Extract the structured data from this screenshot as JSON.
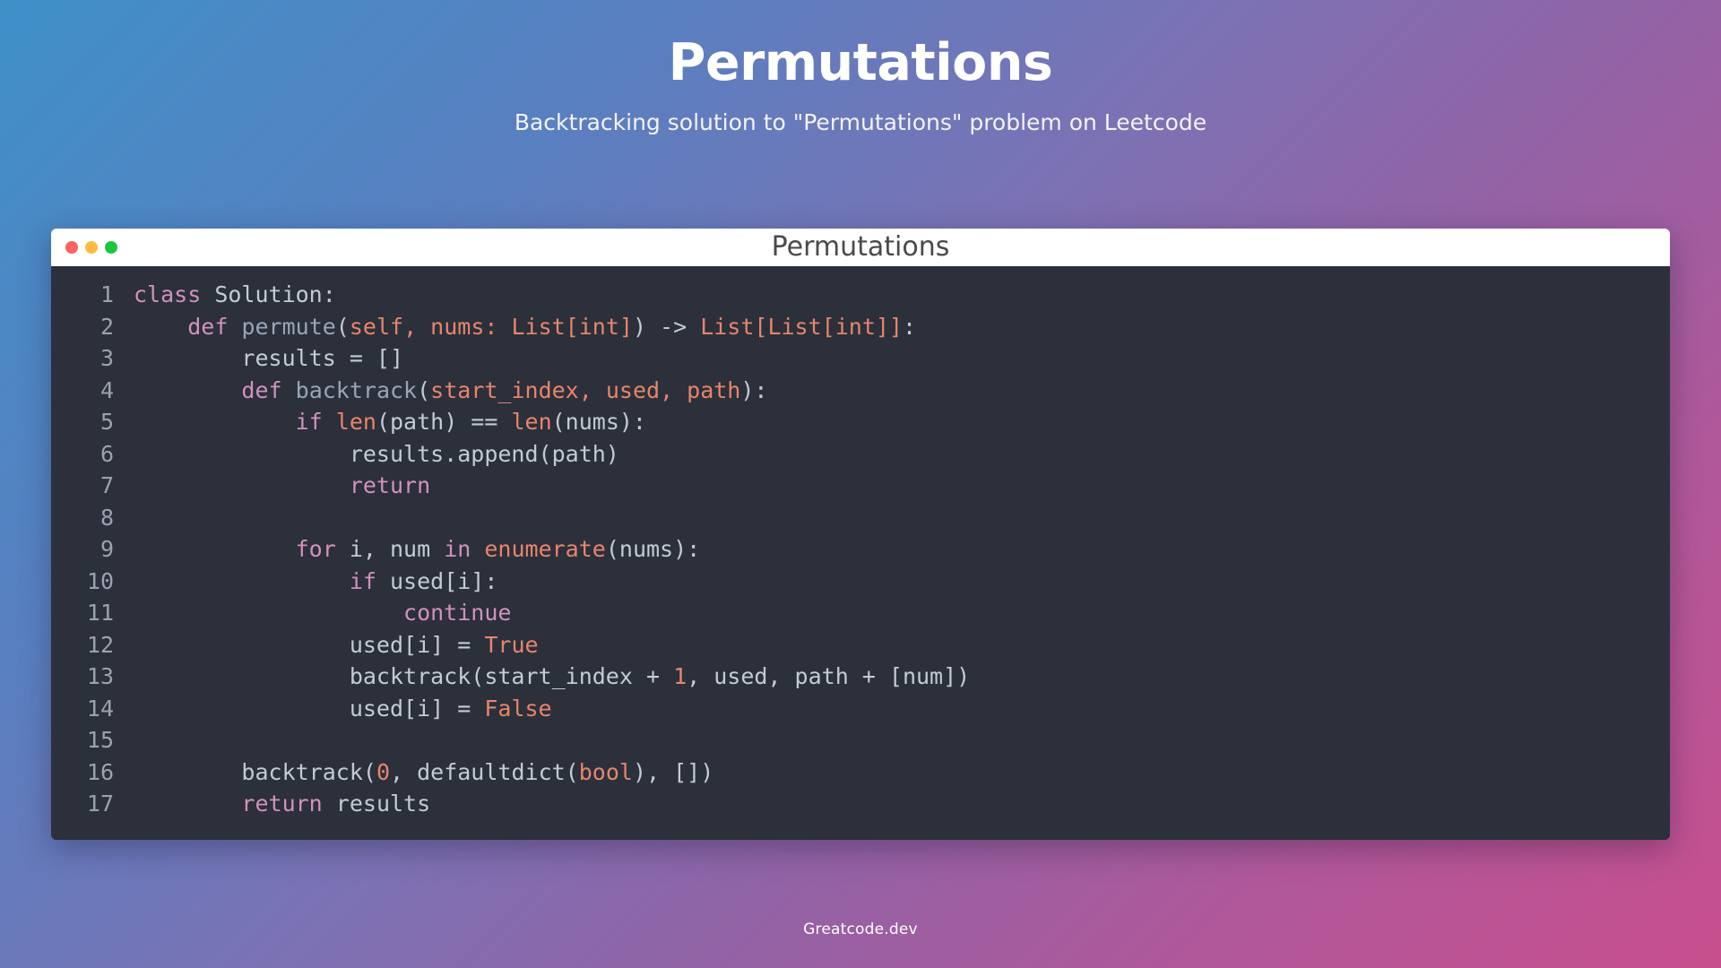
{
  "header": {
    "title": "Permutations",
    "subtitle": "Backtracking solution to \"Permutations\" problem on Leetcode"
  },
  "window": {
    "title": "Permutations",
    "traffic_lights": [
      {
        "name": "close",
        "color": "#fc625d"
      },
      {
        "name": "minimize",
        "color": "#fdbc40"
      },
      {
        "name": "maximize",
        "color": "#1cc73f"
      }
    ]
  },
  "footer": {
    "text": "Greatcode.dev"
  },
  "theme": {
    "background_start": "#3f90c8",
    "background_mid": "#9263a6",
    "background_end": "#c84f8e",
    "editor_background": "#2b303b",
    "titlebar_background": "#ffffff",
    "line_number_color": "#9aa2b1",
    "text_color": "#c5cbd6",
    "keyword_color": "#d291bc",
    "function_color": "#9aa5b8",
    "literal_color": "#e8856b"
  },
  "editor": {
    "language": "python",
    "line_numbers": [
      "1",
      "2",
      "3",
      "4",
      "5",
      "6",
      "7",
      "8",
      "9",
      "10",
      "11",
      "12",
      "13",
      "14",
      "15",
      "16",
      "17"
    ],
    "lines": [
      {
        "n": "1",
        "plain": "class Solution:"
      },
      {
        "n": "2",
        "plain": "    def permute(self, nums: List[int]) -> List[List[int]]:"
      },
      {
        "n": "3",
        "plain": "        results = []"
      },
      {
        "n": "4",
        "plain": "        def backtrack(start_index, used, path):"
      },
      {
        "n": "5",
        "plain": "            if len(path) == len(nums):"
      },
      {
        "n": "6",
        "plain": "                results.append(path)"
      },
      {
        "n": "7",
        "plain": "                return"
      },
      {
        "n": "8",
        "plain": ""
      },
      {
        "n": "9",
        "plain": "            for i, num in enumerate(nums):"
      },
      {
        "n": "10",
        "plain": "                if used[i]:"
      },
      {
        "n": "11",
        "plain": "                    continue"
      },
      {
        "n": "12",
        "plain": "                used[i] = True"
      },
      {
        "n": "13",
        "plain": "                backtrack(start_index + 1, used, path + [num])"
      },
      {
        "n": "14",
        "plain": "                used[i] = False"
      },
      {
        "n": "15",
        "plain": ""
      },
      {
        "n": "16",
        "plain": "        backtrack(0, defaultdict(bool), [])"
      },
      {
        "n": "17",
        "plain": "        return results"
      }
    ],
    "tokens": [
      [
        {
          "t": "class",
          "c": "kw"
        },
        {
          "t": " Solution:",
          "c": "pl"
        }
      ],
      [
        {
          "t": "    ",
          "c": "pl"
        },
        {
          "t": "def",
          "c": "kw"
        },
        {
          "t": " ",
          "c": "pl"
        },
        {
          "t": "permute",
          "c": "fn"
        },
        {
          "t": "(",
          "c": "pl"
        },
        {
          "t": "self, nums: List[int]",
          "c": "par"
        },
        {
          "t": ") -> ",
          "c": "pl"
        },
        {
          "t": "List[List[int]]",
          "c": "par"
        },
        {
          "t": ":",
          "c": "pl"
        }
      ],
      [
        {
          "t": "        results = []",
          "c": "pl"
        }
      ],
      [
        {
          "t": "        ",
          "c": "pl"
        },
        {
          "t": "def",
          "c": "kw"
        },
        {
          "t": " ",
          "c": "pl"
        },
        {
          "t": "backtrack",
          "c": "fn"
        },
        {
          "t": "(",
          "c": "pl"
        },
        {
          "t": "start_index, used, path",
          "c": "par"
        },
        {
          "t": "):",
          "c": "pl"
        }
      ],
      [
        {
          "t": "            ",
          "c": "pl"
        },
        {
          "t": "if",
          "c": "kw"
        },
        {
          "t": " ",
          "c": "pl"
        },
        {
          "t": "len",
          "c": "par"
        },
        {
          "t": "(path) == ",
          "c": "pl"
        },
        {
          "t": "len",
          "c": "par"
        },
        {
          "t": "(nums):",
          "c": "pl"
        }
      ],
      [
        {
          "t": "                results.append(path)",
          "c": "pl"
        }
      ],
      [
        {
          "t": "                ",
          "c": "pl"
        },
        {
          "t": "return",
          "c": "kw"
        }
      ],
      [
        {
          "t": "",
          "c": "pl"
        }
      ],
      [
        {
          "t": "            ",
          "c": "pl"
        },
        {
          "t": "for",
          "c": "kw"
        },
        {
          "t": " i, num ",
          "c": "pl"
        },
        {
          "t": "in",
          "c": "kw"
        },
        {
          "t": " ",
          "c": "pl"
        },
        {
          "t": "enumerate",
          "c": "par"
        },
        {
          "t": "(nums):",
          "c": "pl"
        }
      ],
      [
        {
          "t": "                ",
          "c": "pl"
        },
        {
          "t": "if",
          "c": "kw"
        },
        {
          "t": " used[i]:",
          "c": "pl"
        }
      ],
      [
        {
          "t": "                    ",
          "c": "pl"
        },
        {
          "t": "continue",
          "c": "kw"
        }
      ],
      [
        {
          "t": "                used[i] = ",
          "c": "pl"
        },
        {
          "t": "True",
          "c": "par"
        }
      ],
      [
        {
          "t": "                backtrack(start_index + ",
          "c": "pl"
        },
        {
          "t": "1",
          "c": "par"
        },
        {
          "t": ", used, path + [num])",
          "c": "pl"
        }
      ],
      [
        {
          "t": "                used[i] = ",
          "c": "pl"
        },
        {
          "t": "False",
          "c": "par"
        }
      ],
      [
        {
          "t": "",
          "c": "pl"
        }
      ],
      [
        {
          "t": "        backtrack(",
          "c": "pl"
        },
        {
          "t": "0",
          "c": "par"
        },
        {
          "t": ", defaultdict(",
          "c": "pl"
        },
        {
          "t": "bool",
          "c": "par"
        },
        {
          "t": "), [])",
          "c": "pl"
        }
      ],
      [
        {
          "t": "        ",
          "c": "pl"
        },
        {
          "t": "return",
          "c": "kw"
        },
        {
          "t": " results",
          "c": "pl"
        }
      ]
    ]
  }
}
